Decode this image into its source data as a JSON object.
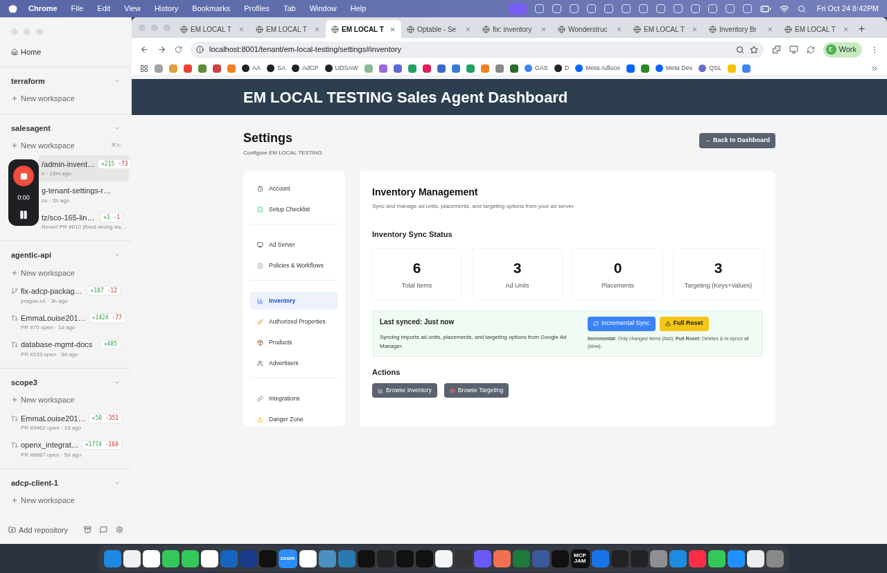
{
  "menu_bar": {
    "app": "Chrome",
    "items": [
      "File",
      "Edit",
      "View",
      "History",
      "Bookmarks",
      "Profiles",
      "Tab",
      "Window",
      "Help"
    ],
    "clock": "Fri Oct 24  8:42PM"
  },
  "app_sidebar": {
    "home": "Home",
    "groups": [
      {
        "name": "terraform",
        "new_workspace": "New workspace"
      },
      {
        "name": "salesagent",
        "new_workspace": "New workspace",
        "shortcut": "⌘N",
        "items": [
          {
            "kind": "branch",
            "title": "/admin-invent…",
            "subtitle": "n · 23m ago",
            "added": "+215",
            "removed": "-73",
            "selected": true
          },
          {
            "kind": "branch",
            "title": "g-tenant-settings-r…",
            "subtitle": "co · 2h ago",
            "selected": false
          },
          {
            "kind": "branch",
            "title": "tz/sco-165-lin…",
            "subtitle": "Revert PR #610 (fixed wrong iss…",
            "added": "+1",
            "removed": "-1",
            "selected": false
          }
        ]
      },
      {
        "name": "agentic-api",
        "new_workspace": "New workspace",
        "items": [
          {
            "kind": "branch",
            "title": "fix-adcp-packag…",
            "subtitle": "prague-v1 · 3h ago",
            "added": "+187",
            "removed": "-12",
            "selected": false
          },
          {
            "kind": "pr",
            "title": "EmmaLouise201…",
            "subtitle": "PR #75 open · 1d ago",
            "added": "+1424",
            "removed": "-77",
            "selected": false
          },
          {
            "kind": "pr",
            "title": "database-mgmt-docs",
            "subtitle": "PR #133 open · 5d ago",
            "added": "+485",
            "selected": false
          }
        ]
      },
      {
        "name": "scope3",
        "new_workspace": "New workspace",
        "items": [
          {
            "kind": "pr",
            "title": "EmmaLouise201…",
            "subtitle": "PR #9462 open · 1d ago",
            "added": "+50",
            "removed": "-351",
            "selected": false
          },
          {
            "kind": "pr",
            "title": "openx_integrat…",
            "subtitle": "PR #8687 open · 5d ago",
            "added": "+1774",
            "removed": "-168",
            "selected": false
          }
        ]
      },
      {
        "name": "adcp-client-1",
        "new_workspace": "New workspace"
      }
    ],
    "footer": "Add repository"
  },
  "recorder": {
    "time": "0:00"
  },
  "browser": {
    "tabs": [
      {
        "title": "EM LOCAL T",
        "selected": false
      },
      {
        "title": "EM LOCAL T",
        "selected": false
      },
      {
        "title": "EM LOCAL T",
        "selected": true
      },
      {
        "title": "Optable - Se",
        "selected": false
      },
      {
        "title": "fix: inventory",
        "selected": false
      },
      {
        "title": "Wonderstruc",
        "selected": false
      },
      {
        "title": "EM LOCAL T",
        "selected": false
      },
      {
        "title": "Inventory Br",
        "selected": false
      },
      {
        "title": "EM LOCAL T",
        "selected": false
      }
    ],
    "url": "localhost:8001/tenant/em-local-testing/settings#inventory",
    "profile": "Work",
    "profile_initial": "E",
    "bookmarks": [
      {
        "kind": "icon"
      },
      {
        "kind": "icon"
      },
      {
        "kind": "icon"
      },
      {
        "kind": "icon"
      },
      {
        "kind": "icon"
      },
      {
        "kind": "icon"
      },
      {
        "kind": "labeled",
        "label": "AA"
      },
      {
        "kind": "labeled",
        "label": "SA"
      },
      {
        "kind": "labeled",
        "label": "AdCP"
      },
      {
        "kind": "labeled",
        "label": "UDSAW"
      },
      {
        "kind": "icon"
      },
      {
        "kind": "icon"
      },
      {
        "kind": "icon"
      },
      {
        "kind": "icon"
      },
      {
        "kind": "icon"
      },
      {
        "kind": "icon"
      },
      {
        "kind": "icon"
      },
      {
        "kind": "icon"
      },
      {
        "kind": "icon"
      },
      {
        "kind": "icon"
      },
      {
        "kind": "icon"
      },
      {
        "kind": "labeled",
        "label": "GAS"
      },
      {
        "kind": "labeled",
        "label": "D"
      },
      {
        "kind": "labeled",
        "label": "Meta Adloox"
      },
      {
        "kind": "icon"
      },
      {
        "kind": "icon"
      },
      {
        "kind": "labeled",
        "label": "Meta Dev"
      },
      {
        "kind": "labeled",
        "label": "QSL"
      },
      {
        "kind": "icon"
      },
      {
        "kind": "icon"
      }
    ]
  },
  "page": {
    "header": "EM LOCAL TESTING Sales Agent Dashboard",
    "title": "Settings",
    "subtitle": "Configure EM LOCAL TESTING",
    "back_button": "← Back to Dashboard",
    "nav": [
      [
        {
          "label": "Account",
          "selected": false
        },
        {
          "label": "Setup Checklist",
          "selected": false
        }
      ],
      [
        {
          "label": "Ad Server",
          "selected": false
        },
        {
          "label": "Policies & Workflows",
          "selected": false
        }
      ],
      [
        {
          "label": "Inventory",
          "selected": true
        },
        {
          "label": "Authorized Properties",
          "selected": false
        },
        {
          "label": "Products",
          "selected": false
        },
        {
          "label": "Advertisers",
          "selected": false
        }
      ],
      [
        {
          "label": "Integrations",
          "selected": false
        },
        {
          "label": "Danger Zone",
          "selected": false
        }
      ]
    ],
    "section_title": "Inventory Management",
    "section_subtitle": "Sync and manage ad units, placements, and targeting options from your ad server",
    "sync_title": "Inventory Sync Status",
    "stats": [
      {
        "value": "6",
        "label": "Total Items"
      },
      {
        "value": "3",
        "label": "Ad Units"
      },
      {
        "value": "0",
        "label": "Placements"
      },
      {
        "value": "3",
        "label": "Targeting (Keys+Values)"
      }
    ],
    "sync_box": {
      "title": "Last synced: Just now",
      "text": "Syncing imports ad units, placements, and targeting options from Google Ad Manager.",
      "incremental_button": "Incremental Sync",
      "reset_button": "Full Reset",
      "note": "**Incremental:** Only changed items (fast). **Full Reset:** Deletes & re-syncs all (slow)."
    },
    "actions_title": "Actions",
    "actions": [
      "Browse Inventory",
      "Browse Targeting"
    ]
  },
  "dock": [
    {
      "kind": "icon"
    },
    {
      "kind": "icon"
    },
    {
      "kind": "icon"
    },
    {
      "kind": "icon"
    },
    {
      "kind": "icon"
    },
    {
      "kind": "icon"
    },
    {
      "kind": "icon"
    },
    {
      "kind": "icon"
    },
    {
      "kind": "icon"
    },
    {
      "kind": "text",
      "label": "zoom"
    },
    {
      "kind": "icon"
    },
    {
      "kind": "icon"
    },
    {
      "kind": "icon"
    },
    {
      "kind": "icon"
    },
    {
      "kind": "icon"
    },
    {
      "kind": "icon"
    },
    {
      "kind": "icon"
    },
    {
      "kind": "icon"
    },
    {
      "kind": "icon"
    },
    {
      "kind": "icon"
    },
    {
      "kind": "icon"
    },
    {
      "kind": "icon"
    },
    {
      "kind": "icon"
    },
    {
      "kind": "icon"
    },
    {
      "kind": "text",
      "label": "MCP JAM"
    },
    {
      "kind": "icon"
    },
    {
      "kind": "icon"
    },
    {
      "kind": "icon"
    },
    {
      "kind": "icon"
    },
    {
      "kind": "icon"
    },
    {
      "kind": "icon"
    },
    {
      "kind": "icon"
    },
    {
      "kind": "icon"
    },
    {
      "kind": "icon"
    },
    {
      "kind": "icon"
    }
  ]
}
